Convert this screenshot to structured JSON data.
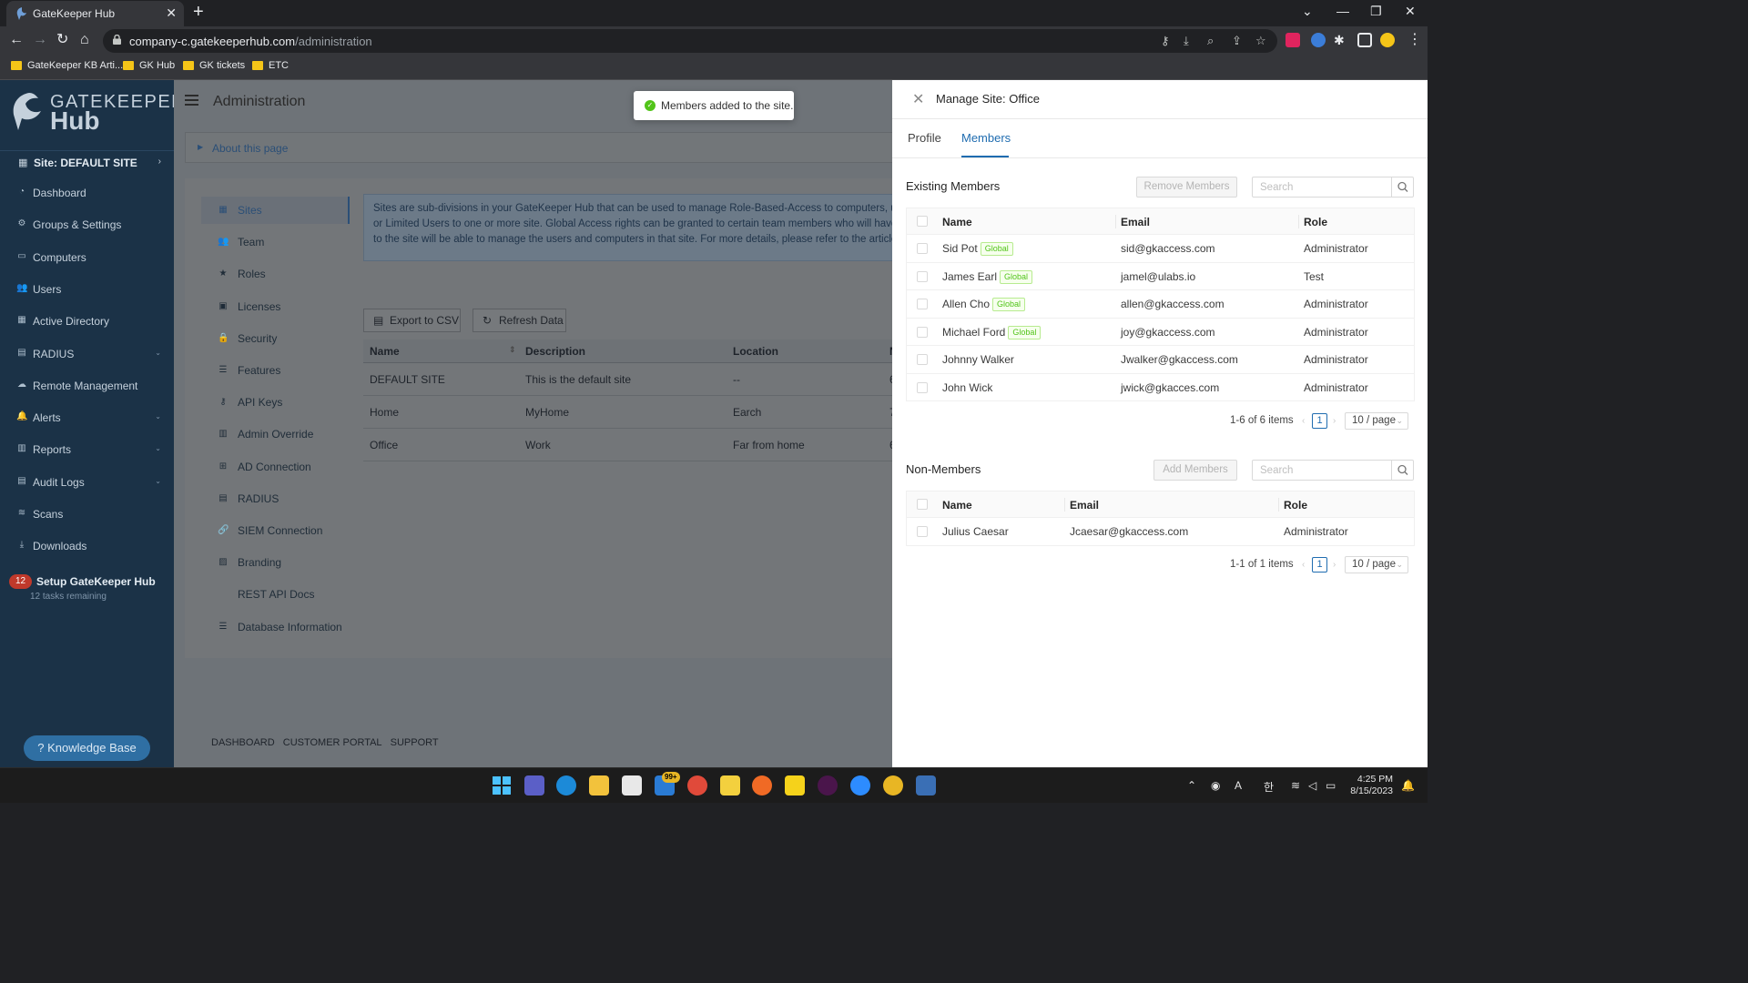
{
  "browser": {
    "tab_title": "GateKeeper Hub",
    "url_host": "company-c.gatekeeperhub.com",
    "url_path": "/administration",
    "bookmarks": [
      "GateKeeper KB Arti...",
      "GK Hub",
      "GK tickets",
      "ETC"
    ]
  },
  "sidebar": {
    "logo_word1": "GATEKEEPER",
    "logo_word2": "Hub",
    "site_label": "Site: DEFAULT SITE",
    "items": [
      {
        "label": "Dashboard",
        "icon": "dashboard-icon",
        "expandable": false
      },
      {
        "label": "Groups & Settings",
        "icon": "gears-icon",
        "expandable": false
      },
      {
        "label": "Computers",
        "icon": "computer-icon",
        "expandable": false
      },
      {
        "label": "Users",
        "icon": "users-icon",
        "expandable": false
      },
      {
        "label": "Active Directory",
        "icon": "directory-icon",
        "expandable": false
      },
      {
        "label": "RADIUS",
        "icon": "radius-icon",
        "expandable": true
      },
      {
        "label": "Remote Management",
        "icon": "remote-icon",
        "expandable": false
      },
      {
        "label": "Alerts",
        "icon": "bell-icon",
        "expandable": true
      },
      {
        "label": "Reports",
        "icon": "reports-icon",
        "expandable": true
      },
      {
        "label": "Audit Logs",
        "icon": "logs-icon",
        "expandable": true
      },
      {
        "label": "Scans",
        "icon": "wifi-icon",
        "expandable": false
      },
      {
        "label": "Downloads",
        "icon": "download-icon",
        "expandable": false
      }
    ],
    "setup_badge": "12",
    "setup_title": "Setup GateKeeper Hub",
    "setup_sub": "12 tasks remaining",
    "knowledge_base": "Knowledge Base"
  },
  "main": {
    "title": "Administration",
    "about": "About this page",
    "subnav": [
      {
        "label": "Sites",
        "icon": "sites-icon",
        "active": true
      },
      {
        "label": "Team",
        "icon": "team-icon",
        "active": false
      },
      {
        "label": "Roles",
        "icon": "star-icon",
        "active": false
      },
      {
        "label": "Licenses",
        "icon": "license-icon",
        "active": false
      },
      {
        "label": "Security",
        "icon": "lock-icon",
        "active": false
      },
      {
        "label": "Features",
        "icon": "list-icon",
        "active": false
      },
      {
        "label": "API Keys",
        "icon": "key-icon",
        "active": false
      },
      {
        "label": "Admin Override",
        "icon": "override-icon",
        "active": false
      },
      {
        "label": "AD Connection",
        "icon": "windows-icon",
        "active": false
      },
      {
        "label": "RADIUS",
        "icon": "server-icon",
        "active": false
      },
      {
        "label": "SIEM Connection",
        "icon": "link-icon",
        "active": false
      },
      {
        "label": "Branding",
        "icon": "image-icon",
        "active": false
      },
      {
        "label": "REST API Docs",
        "icon": "code-icon",
        "active": false
      },
      {
        "label": "Database Information",
        "icon": "database-icon",
        "active": false
      }
    ],
    "info_lines": [
      "Sites are sub-divisions in your GateKeeper Hub that can be used to manage Role-Based-Access to computers, users, a",
      "or Limited Users to one or more site. Global Access rights can be granted to certain team members who will have acc",
      "to the site will be able to manage the users and computers in that site. For more details, please refer to the article link"
    ],
    "export_label": "Export to CSV",
    "refresh_label": "Refresh Data",
    "columns": [
      "Name",
      "Description",
      "Location",
      "N"
    ],
    "rows": [
      {
        "name": "DEFAULT SITE",
        "description": "This is the default site",
        "location": "--",
        "n": "6"
      },
      {
        "name": "Home",
        "description": "MyHome",
        "location": "Earch",
        "n": "7"
      },
      {
        "name": "Office",
        "description": "Work",
        "location": "Far from home",
        "n": "6"
      }
    ],
    "footer": [
      "DASHBOARD",
      "CUSTOMER PORTAL",
      "SUPPORT"
    ]
  },
  "toast": {
    "message": "Members added to the site."
  },
  "drawer": {
    "title": "Manage Site: Office",
    "tabs": [
      "Profile",
      "Members"
    ],
    "active_tab": "Members",
    "existing": {
      "title": "Existing Members",
      "action": "Remove Members",
      "search_placeholder": "Search",
      "columns": [
        "Name",
        "Email",
        "Role"
      ],
      "rows": [
        {
          "name": "Sid Pot",
          "tag": "Global",
          "email": "sid@gkaccess.com",
          "role": "Administrator"
        },
        {
          "name": "James Earl",
          "tag": "Global",
          "email": "jamel@ulabs.io",
          "role": "Test"
        },
        {
          "name": "Allen Cho",
          "tag": "Global",
          "email": "allen@gkaccess.com",
          "role": "Administrator"
        },
        {
          "name": "Michael Ford",
          "tag": "Global",
          "email": "joy@gkaccess.com",
          "role": "Administrator"
        },
        {
          "name": "Johnny Walker",
          "tag": "",
          "email": "Jwalker@gkaccess.com",
          "role": "Administrator"
        },
        {
          "name": "John Wick",
          "tag": "",
          "email": "jwick@gkacces.com",
          "role": "Administrator"
        }
      ],
      "range": "1-6 of 6 items",
      "page": "1",
      "page_size": "10 / page"
    },
    "non_members": {
      "title": "Non-Members",
      "action": "Add Members",
      "search_placeholder": "Search",
      "columns": [
        "Name",
        "Email",
        "Role"
      ],
      "rows": [
        {
          "name": "Julius Caesar",
          "email": "Jcaesar@gkaccess.com",
          "role": "Administrator"
        }
      ],
      "range": "1-1 of 1 items",
      "page": "1",
      "page_size": "10 / page"
    }
  },
  "taskbar": {
    "mail_badge": "99+",
    "time": "4:25 PM",
    "date": "8/15/2023"
  },
  "colors": {
    "sidebar_bg": "#1b3247",
    "accent": "#1f6cb0",
    "tag_green": "#52c41a"
  }
}
